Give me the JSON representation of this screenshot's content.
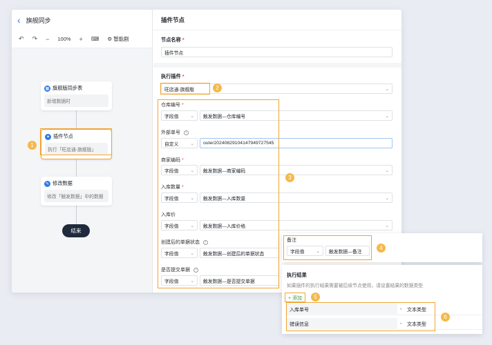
{
  "header": {
    "back_icon": "chevron-left-icon",
    "title": "旗舰同步"
  },
  "toolbar": {
    "zoom": "100%",
    "smart_label": "智能剧"
  },
  "flow": {
    "nodes": [
      {
        "title": "旗舰版同步表",
        "desc": "新增数据时"
      },
      {
        "title": "插件节点",
        "desc": "执行「旺店通-旗舰版」"
      },
      {
        "title": "修改数据",
        "desc": "修改「触发数据」中的数据"
      }
    ],
    "end_label": "结束"
  },
  "panel": {
    "title": "插件节点",
    "node_name_label": "节点名称",
    "node_name_value": "插件节点",
    "plugin_label": "执行插件",
    "plugin_value": "旺店通-旗舰版",
    "fields": [
      {
        "label": "仓库编号",
        "required": "*",
        "type": "字段值",
        "value": "触发数据—仓库编号"
      },
      {
        "label": "外部单号",
        "required": "",
        "type": "自定义",
        "value": "outer20240829104147949727545"
      },
      {
        "label": "商家编码",
        "required": "*",
        "type": "字段值",
        "value": "触发数据—商家编码"
      },
      {
        "label": "入库数量",
        "required": "*",
        "type": "字段值",
        "value": "触发数据—入库数量"
      },
      {
        "label": "入库价",
        "required": "",
        "type": "字段值",
        "value": "触发数据—入库价格"
      },
      {
        "label": "创建后的单据状态",
        "required": "",
        "type": "字段值",
        "value": "触发数据—创建后的单据状态"
      },
      {
        "label": "是否提交单据",
        "required": "",
        "type": "字段值",
        "value": "触发数据—是否提交单据"
      }
    ]
  },
  "remark": {
    "label": "备注",
    "type": "字段值",
    "value": "触发数据—备注"
  },
  "result": {
    "title": "执行结果",
    "desc": "如果插件的执行结果需要被后续节点使用，请设置结果的数据类型",
    "add_label": "+ 添加",
    "rows": [
      {
        "name": "入库单号",
        "sep": "-",
        "type": "文本类型"
      },
      {
        "name": "错误信息",
        "sep": "-",
        "type": "文本类型"
      }
    ]
  },
  "badges": [
    "1",
    "2",
    "3",
    "4",
    "5",
    "6"
  ],
  "colors": {
    "accent": "#2d7be5",
    "highlight": "#f0a431",
    "badge": "#f5b94a"
  }
}
